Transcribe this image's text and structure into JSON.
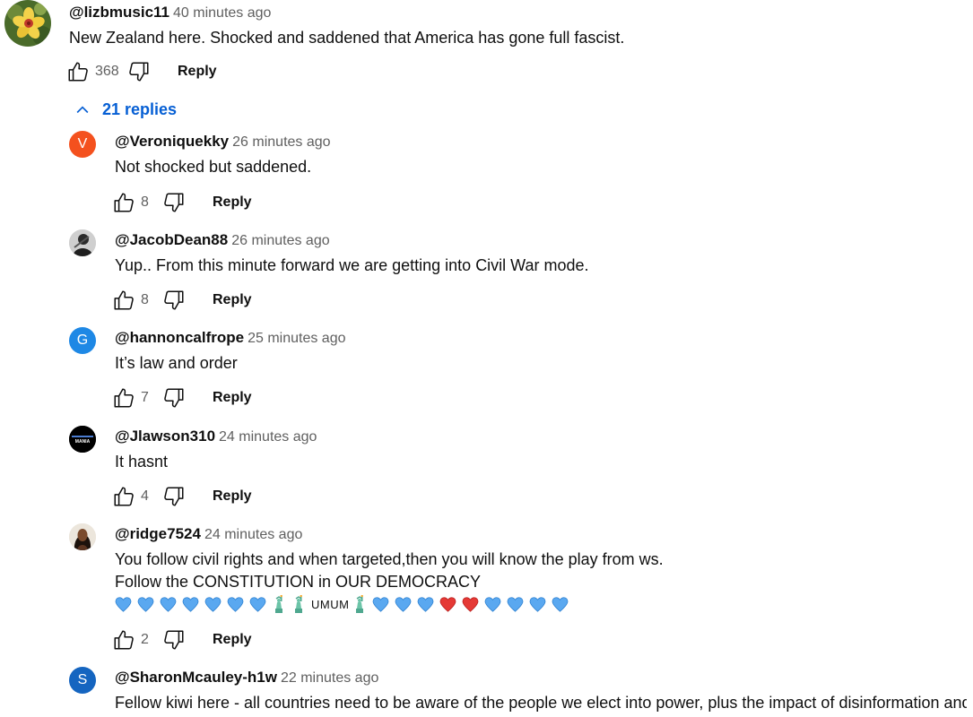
{
  "top_comment": {
    "author": "@lizbmusic11",
    "time": "40 minutes ago",
    "text": "New Zealand here. Shocked and saddened that America has gone full fascist.",
    "likes": "368",
    "reply_label": "Reply"
  },
  "replies_toggle": {
    "label": "21 replies"
  },
  "replies": [
    {
      "author": "@Veroniquekky",
      "time": "26 minutes ago",
      "lines": [
        "Not shocked but saddened."
      ],
      "likes": "8",
      "reply_label": "Reply",
      "avatar_letter": "V",
      "avatar_color": "#f4511e"
    },
    {
      "author": "@JacobDean88",
      "time": "26 minutes ago",
      "lines": [
        "Yup.. From this minute forward we are getting into Civil War mode."
      ],
      "likes": "8",
      "reply_label": "Reply"
    },
    {
      "author": "@hannoncalfrope",
      "time": "25 minutes ago",
      "lines": [
        "It’s law and order"
      ],
      "likes": "7",
      "reply_label": "Reply",
      "avatar_letter": "G",
      "avatar_color": "#1e88e5"
    },
    {
      "author": "@Jlawson310",
      "time": "24 minutes ago",
      "lines": [
        "It hasnt"
      ],
      "likes": "4",
      "reply_label": "Reply",
      "avatar_text": "MANIA"
    },
    {
      "author": "@ridge7524",
      "time": "24 minutes ago",
      "lines": [
        "You follow civil rights and when targeted,then you will know the play from ws.",
        "Follow the CONSTITUTION in OUR DEMOCRACY"
      ],
      "likes": "2",
      "reply_label": "Reply",
      "emoji_text": "UMUM"
    },
    {
      "author": "@SharonMcauley-h1w",
      "time": "22 minutes ago",
      "lines": [
        "Fellow kiwi here - all countries need to be aware of the people we elect into power, plus the impact of disinformation and"
      ],
      "avatar_letter": "S",
      "avatar_color": "#1565c0"
    }
  ],
  "colors": {
    "link": "#065fd4",
    "muted": "#606060",
    "text": "#0f0f0f"
  }
}
